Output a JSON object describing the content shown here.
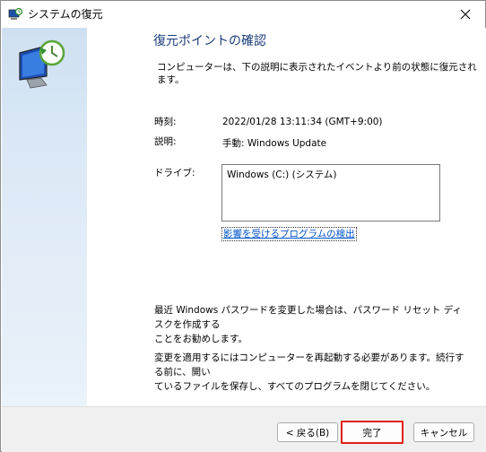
{
  "window": {
    "title": "システムの復元",
    "icons": {
      "title": "system-restore-icon",
      "close": "close-icon",
      "side": "restore-computer-icon"
    }
  },
  "main": {
    "heading": "復元ポイントの確認",
    "description": "コンピューターは、下の説明に表示されたイベントより前の状態に復元されます。",
    "time_label": "時刻:",
    "time_value": "2022/01/28 13:11:34 (GMT+9:00)",
    "desc_label": "説明:",
    "desc_value": "手動: Windows Update",
    "drive_label": "ドライブ:",
    "drive_value": "Windows (C:) (システム)",
    "affected_link": "影響を受けるプログラムの検出",
    "password_note_line1": "最近 Windows パスワードを変更した場合は、パスワード リセット ディスクを作成する",
    "password_note_line2": "ことをお勧めします。",
    "restart_note_line1": "変更を適用するにはコンピューターを再起動する必要があります。続行する前に、開い",
    "restart_note_line2": "ているファイルを保存し、すべてのプログラムを閉じてください。"
  },
  "buttons": {
    "back": "< 戻る(B)",
    "finish": "完了",
    "cancel": "キャンセル"
  },
  "colors": {
    "heading": "#1a3c7a",
    "link": "#0055cc",
    "highlight": "#e0201a"
  }
}
